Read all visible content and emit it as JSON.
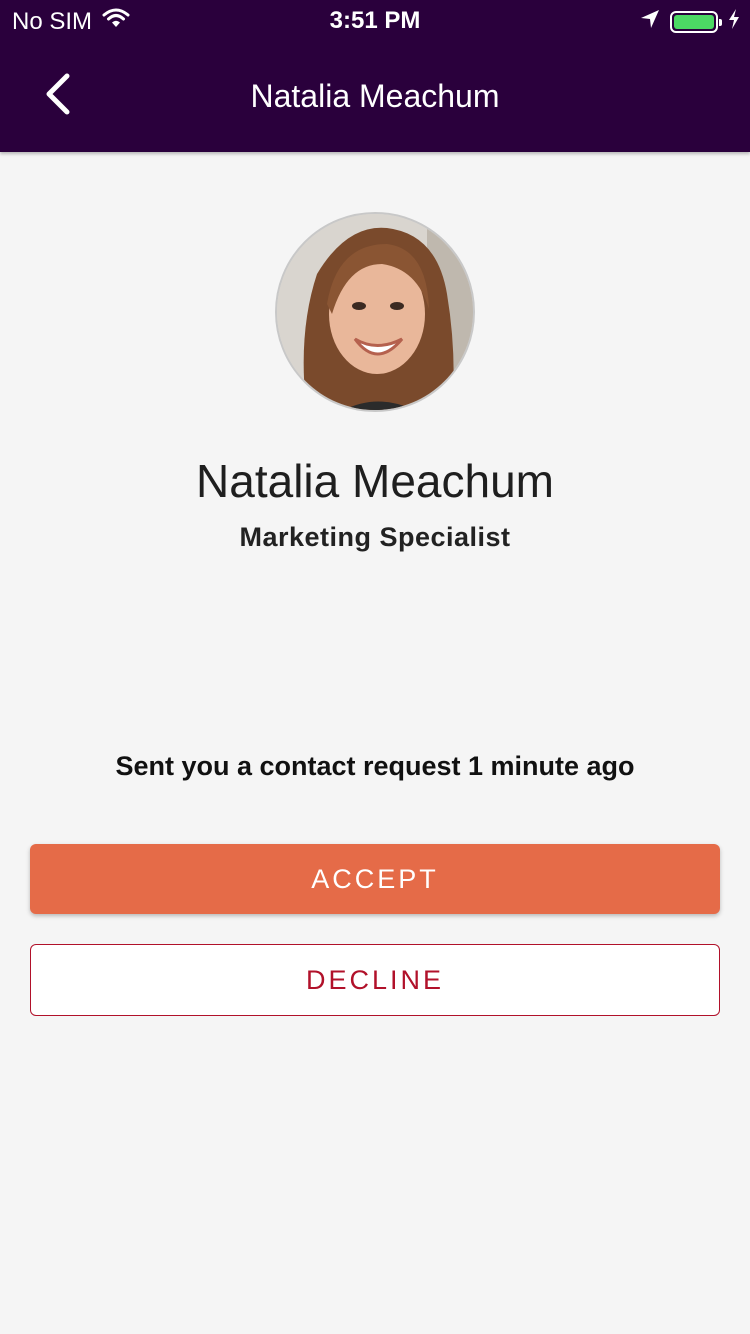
{
  "status_bar": {
    "carrier": "No SIM",
    "time": "3:51 PM",
    "battery_color": "#4cd964",
    "icons": [
      "wifi-icon",
      "location-arrow-icon",
      "battery-icon",
      "charging-bolt-icon"
    ]
  },
  "nav": {
    "title": "Natalia Meachum",
    "back_icon": "chevron-left-icon",
    "background": "#2a003c"
  },
  "profile": {
    "name": "Natalia Meachum",
    "role": "Marketing Specialist"
  },
  "request": {
    "message": "Sent you a contact request 1 minute ago"
  },
  "actions": {
    "accept_label": "ACCEPT",
    "accept_color": "#e56b48",
    "decline_label": "DECLINE",
    "decline_color": "#b1112a"
  }
}
